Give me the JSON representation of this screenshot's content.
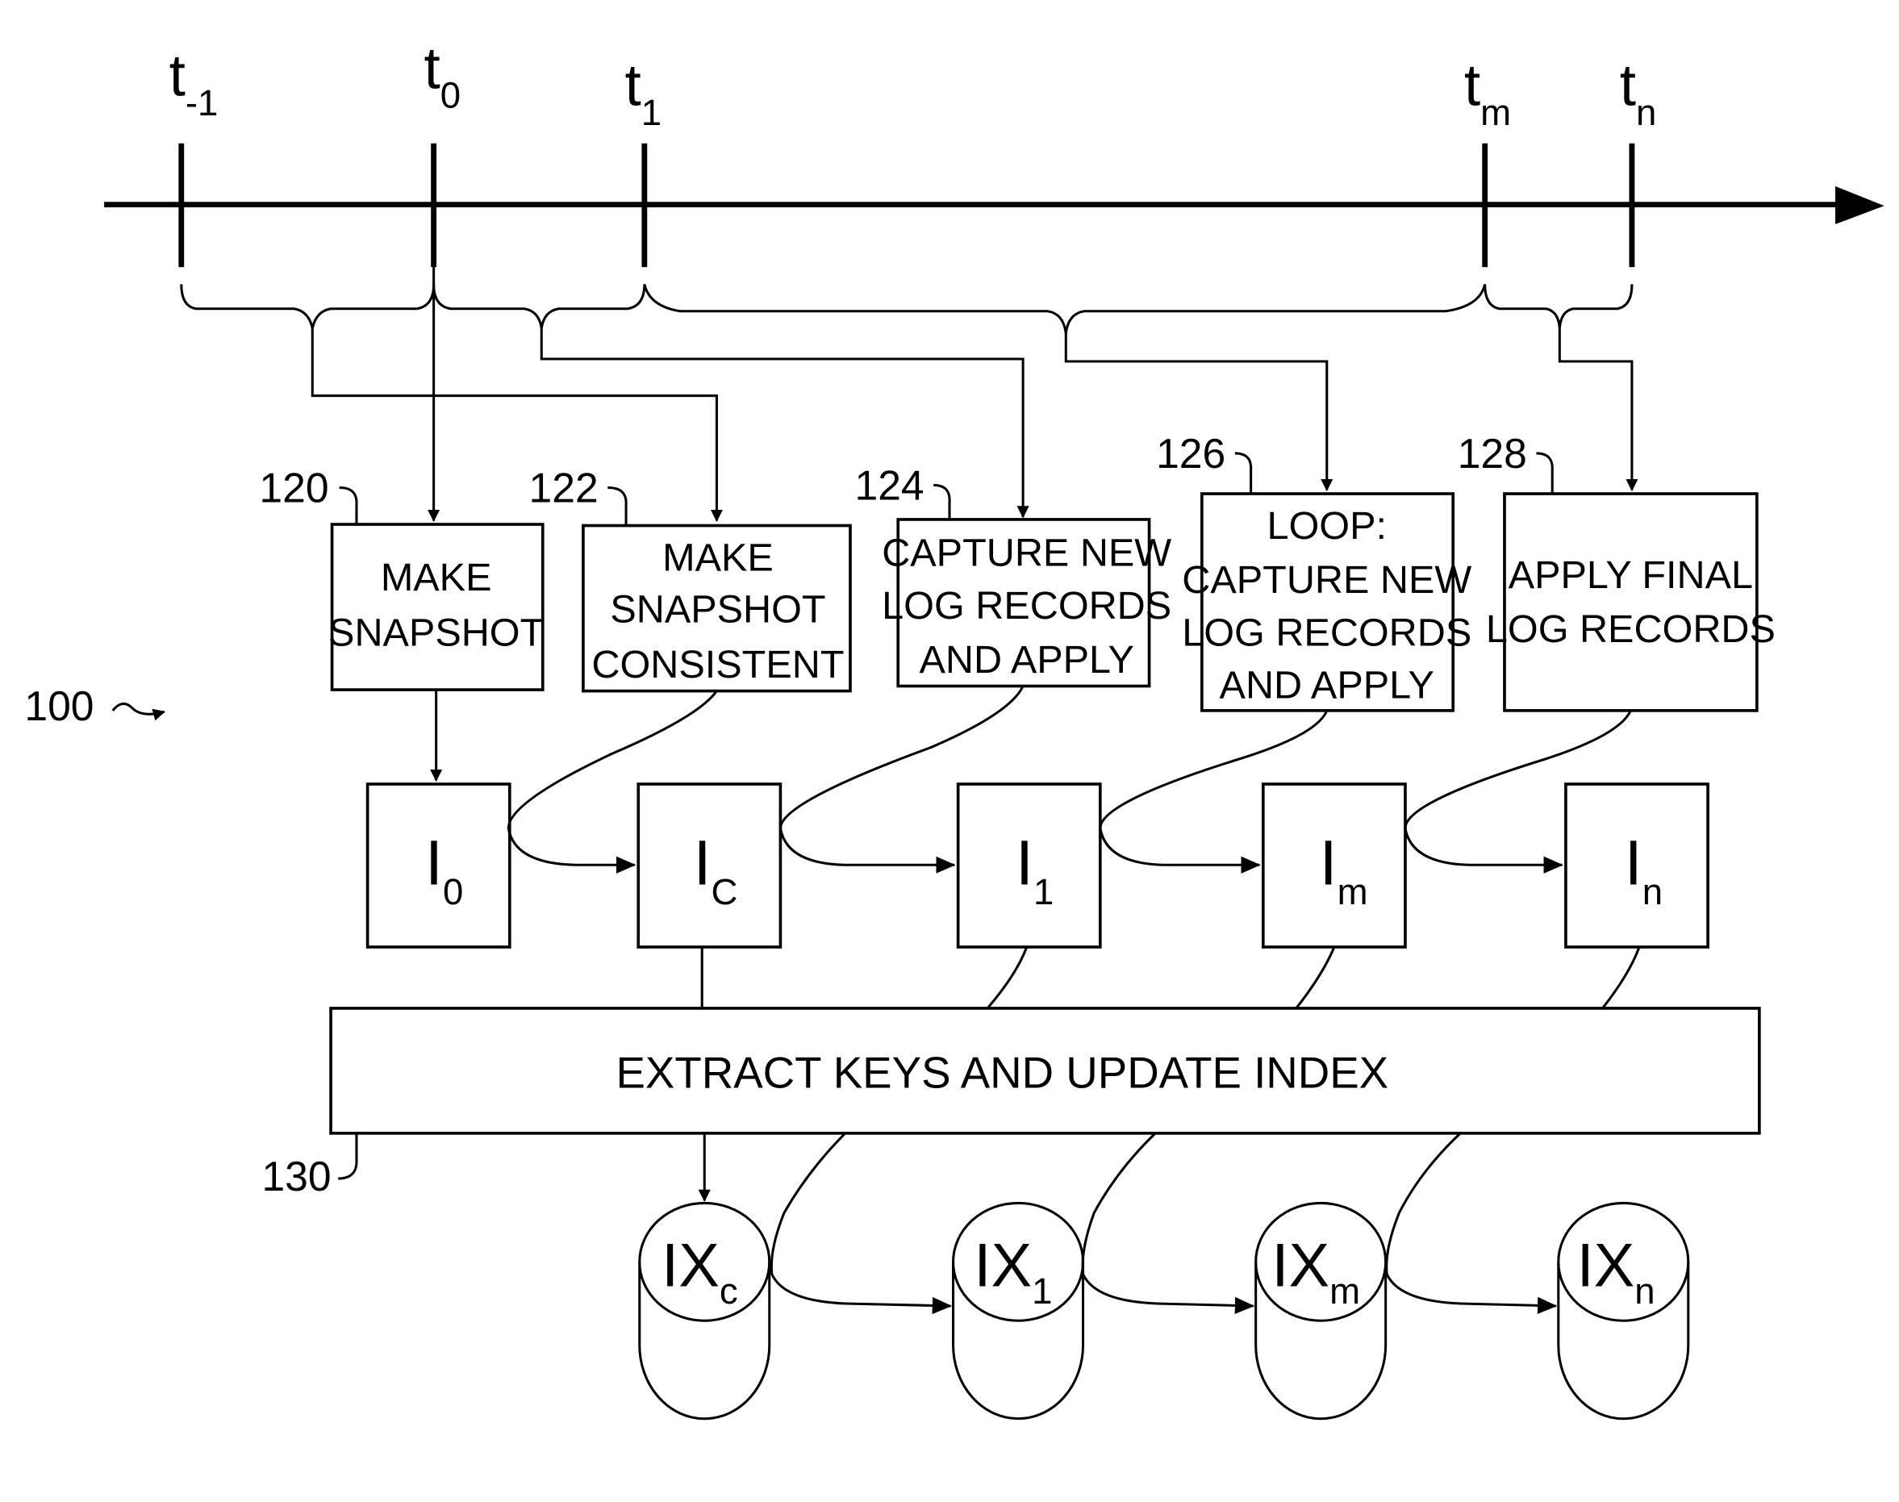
{
  "figure_label": "100",
  "timeline": {
    "ticks": [
      {
        "base": "t",
        "sub": "-1"
      },
      {
        "base": "t",
        "sub": "0"
      },
      {
        "base": "t",
        "sub": "1"
      },
      {
        "base": "t",
        "sub": "m"
      },
      {
        "base": "t",
        "sub": "n"
      }
    ]
  },
  "steps": [
    {
      "ref": "120",
      "lines": [
        "MAKE",
        "SNAPSHOT"
      ]
    },
    {
      "ref": "122",
      "lines": [
        "MAKE",
        "SNAPSHOT",
        "CONSISTENT"
      ]
    },
    {
      "ref": "124",
      "lines": [
        "CAPTURE NEW",
        "LOG RECORDS",
        "AND APPLY"
      ]
    },
    {
      "ref": "126",
      "lines": [
        "LOOP:",
        "CAPTURE NEW",
        "LOG RECORDS",
        "AND APPLY"
      ]
    },
    {
      "ref": "128",
      "lines": [
        "APPLY FINAL",
        "LOG RECORDS"
      ]
    }
  ],
  "images": [
    {
      "base": "I",
      "sub": "0"
    },
    {
      "base": "I",
      "sub": "C"
    },
    {
      "base": "I",
      "sub": "1"
    },
    {
      "base": "I",
      "sub": "m"
    },
    {
      "base": "I",
      "sub": "n"
    }
  ],
  "index_step": {
    "ref": "130",
    "label": "EXTRACT KEYS AND UPDATE INDEX"
  },
  "indexes": [
    {
      "base": "IX",
      "sub": "c"
    },
    {
      "base": "IX",
      "sub": "1"
    },
    {
      "base": "IX",
      "sub": "m"
    },
    {
      "base": "IX",
      "sub": "n"
    }
  ]
}
